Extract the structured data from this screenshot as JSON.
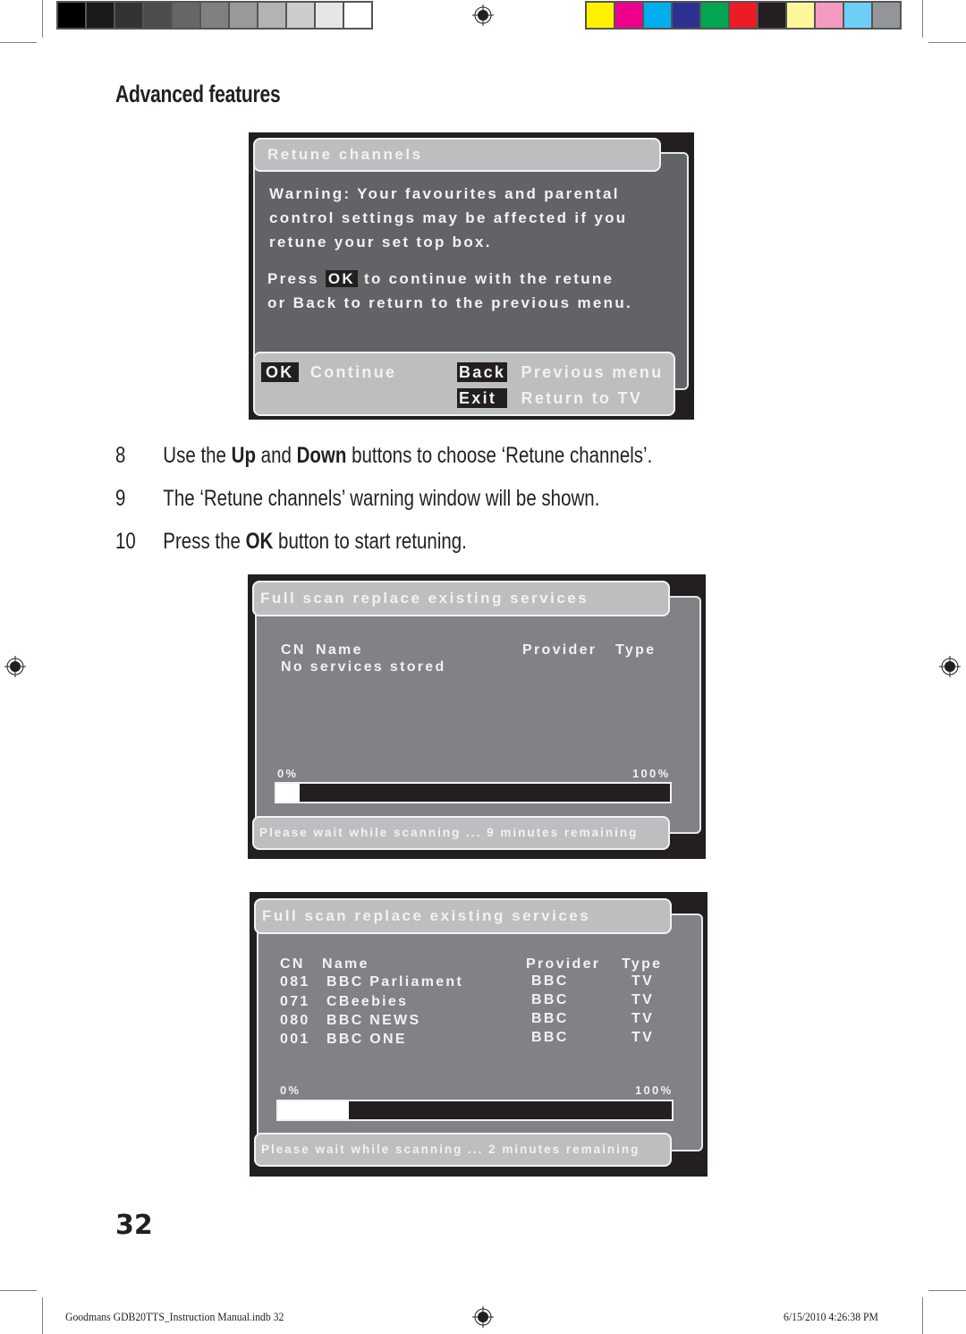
{
  "color_bars": {
    "grayscale": [
      "#000000",
      "#1a1a1a",
      "#333333",
      "#4d4d4d",
      "#666666",
      "#808080",
      "#999999",
      "#b3b3b3",
      "#cccccc",
      "#e6e6e6",
      "#ffffff"
    ],
    "process": [
      "#fff200",
      "#ec008c",
      "#00aeef",
      "#2e3192",
      "#00a651",
      "#ed1c24",
      "#231f20",
      "#fff799",
      "#f49ac1",
      "#6dcff6",
      "#939598"
    ]
  },
  "section_heading": "Advanced features",
  "retune_dialog": {
    "title": "Retune channels",
    "warning_lines": [
      "Warning: Your favourites and parental",
      "control settings may be affected if you",
      "retune your set top box."
    ],
    "instruction_prefix": "Press",
    "instruction_key": "OK",
    "instruction_suffix": "to continue with the retune",
    "instruction_line2": "or Back to return to the previous menu.",
    "footer": {
      "ok_key": "OK",
      "ok_label": "Continue",
      "back_key": "Back",
      "back_label": "Previous menu",
      "exit_key": "Exit",
      "exit_label": "Return to TV"
    }
  },
  "steps": [
    {
      "number": "8",
      "parts": [
        "Use the ",
        "Up",
        " and ",
        "Down",
        " buttons to choose ‘Retune channels’."
      ]
    },
    {
      "number": "9",
      "text": "The ‘Retune channels’ warning window will be shown."
    },
    {
      "number": "10",
      "parts": [
        "Press the ",
        "OK",
        " button to start retuning."
      ]
    }
  ],
  "scan_dialog_1": {
    "title": "Full scan replace existing services",
    "columns": {
      "cn": "CN",
      "name": "Name",
      "provider": "Provider",
      "type": "Type"
    },
    "empty_message": "No services stored",
    "progress_min_label": "0%",
    "progress_max_label": "100%",
    "progress_percent": 6,
    "status": "Please wait while scanning ... 9 minutes remaining"
  },
  "scan_dialog_2": {
    "title": "Full scan replace existing services",
    "columns": {
      "cn": "CN",
      "name": "Name",
      "provider": "Provider",
      "type": "Type"
    },
    "rows": [
      {
        "cn": "081",
        "name": "BBC Parliament",
        "provider": "BBC",
        "type": "TV"
      },
      {
        "cn": "071",
        "name": "CBeebies",
        "provider": "BBC",
        "type": "TV"
      },
      {
        "cn": "080",
        "name": "BBC NEWS",
        "provider": "BBC",
        "type": "TV"
      },
      {
        "cn": "001",
        "name": "BBC ONE",
        "provider": "BBC",
        "type": "TV"
      }
    ],
    "progress_min_label": "0%",
    "progress_max_label": "100%",
    "progress_percent": 18,
    "status": "Please wait while scanning ... 2 minutes remaining"
  },
  "page_number": "32",
  "slug": {
    "file": "Goodmans GDB20TTS_Instruction Manual.indb   32",
    "timestamp": "6/15/2010   4:26:38 PM"
  }
}
